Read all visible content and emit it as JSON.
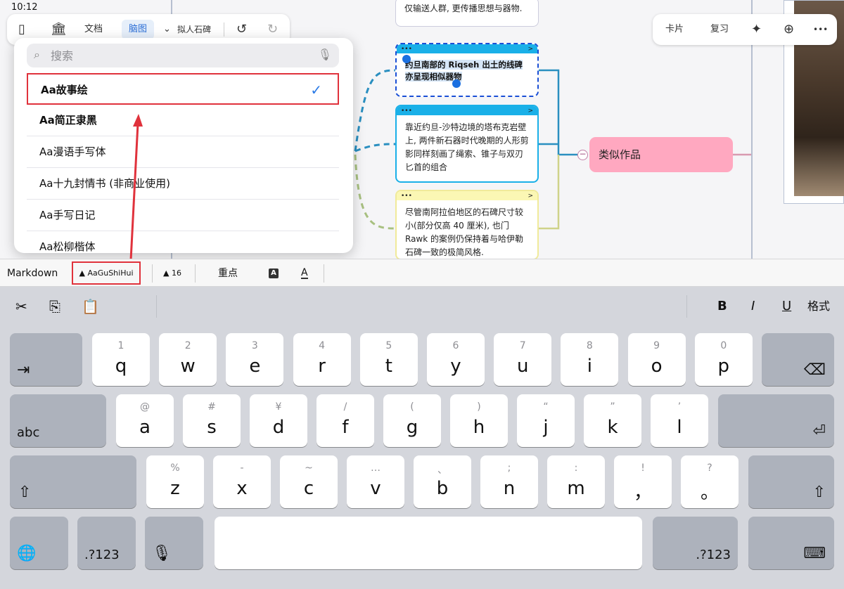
{
  "status": {
    "time": "10:12"
  },
  "canvas": {
    "top_card_text": "仅输送人群, 更传播思想与器物.",
    "node_1_text": "约旦南部的 Riqseh 出土的线碑亦呈现相似器物",
    "node_2_text": "靠近约旦-沙特边境的塔布克岩壁上, 两件新石器时代晚期的人形剪影同样刻画了绳索、锥子与双刃匕首的组合",
    "node_3_text": "尽管南阿拉伯地区的石碑尺寸较小(部分仅高 40 厘米), 也门 Rawk 的案例仍保持着与哈伊勒石碑一致的极简风格.",
    "similar_works": "类似作品",
    "collapse_symbol": "−",
    "node_dots": "•••",
    "node_chevron": ">"
  },
  "left_toolbar": {
    "sidebar_icon": "▯",
    "library_icon": "🏛",
    "doc_tab": "文档",
    "mindmap_tab": "脑图",
    "title_chevron": "⌄",
    "title": "拟人石碑",
    "undo": "↺",
    "redo": "↻"
  },
  "right_toolbar": {
    "card": "卡片",
    "review": "复习",
    "ai_icon": "✦",
    "web_icon": "⊕",
    "more": "•••"
  },
  "font_picker": {
    "search_placeholder": "搜索",
    "search_icon": "⌕",
    "mic_icon": "🎙",
    "check": "✓",
    "fonts": [
      "Aa故事绘",
      "Aa简正隶黑",
      "Aa漫语手写体",
      "Aa十九封情书 (非商业使用)",
      "Aa手写日记",
      "Aa松柳楷体"
    ]
  },
  "format_bar": {
    "markdown": "Markdown",
    "font_name": "▲ AaGuShiHui",
    "font_size": "▲ 16",
    "emphasis": "重点",
    "highlight_a": "A",
    "underline_a": "A"
  },
  "keyboard": {
    "shortcuts": {
      "cut": "✂",
      "copy": "⎘",
      "paste": "📋",
      "bold": "B",
      "italic": "I",
      "underline": "U",
      "format": "格式"
    },
    "row1": [
      {
        "sub": "1",
        "main": "q"
      },
      {
        "sub": "2",
        "main": "w"
      },
      {
        "sub": "3",
        "main": "e"
      },
      {
        "sub": "4",
        "main": "r"
      },
      {
        "sub": "5",
        "main": "t"
      },
      {
        "sub": "6",
        "main": "y"
      },
      {
        "sub": "7",
        "main": "u"
      },
      {
        "sub": "8",
        "main": "i"
      },
      {
        "sub": "9",
        "main": "o"
      },
      {
        "sub": "0",
        "main": "p"
      }
    ],
    "row2": [
      {
        "sub": "@",
        "main": "a"
      },
      {
        "sub": "#",
        "main": "s"
      },
      {
        "sub": "¥",
        "main": "d"
      },
      {
        "sub": "/",
        "main": "f"
      },
      {
        "sub": "(",
        "main": "g"
      },
      {
        "sub": ")",
        "main": "h"
      },
      {
        "sub": "“",
        "main": "j"
      },
      {
        "sub": "”",
        "main": "k"
      },
      {
        "sub": "’",
        "main": "l"
      }
    ],
    "row3": [
      {
        "sub": "%",
        "main": "z"
      },
      {
        "sub": "-",
        "main": "x"
      },
      {
        "sub": "~",
        "main": "c"
      },
      {
        "sub": "…",
        "main": "v"
      },
      {
        "sub": "、",
        "main": "b"
      },
      {
        "sub": ";",
        "main": "n"
      },
      {
        "sub": ":",
        "main": "m"
      },
      {
        "sub": "!",
        "main": "，"
      },
      {
        "sub": "?",
        "main": "。"
      }
    ],
    "tab_icon": "⇥",
    "delete_icon": "⌫",
    "abc": "abc",
    "return_icon": "⏎",
    "shift_icon": "⇧",
    "globe_icon": "🌐",
    "num_left": ".?123",
    "mic_icon": "🎙",
    "num_right": ".?123",
    "hide_icon": "⌨"
  }
}
